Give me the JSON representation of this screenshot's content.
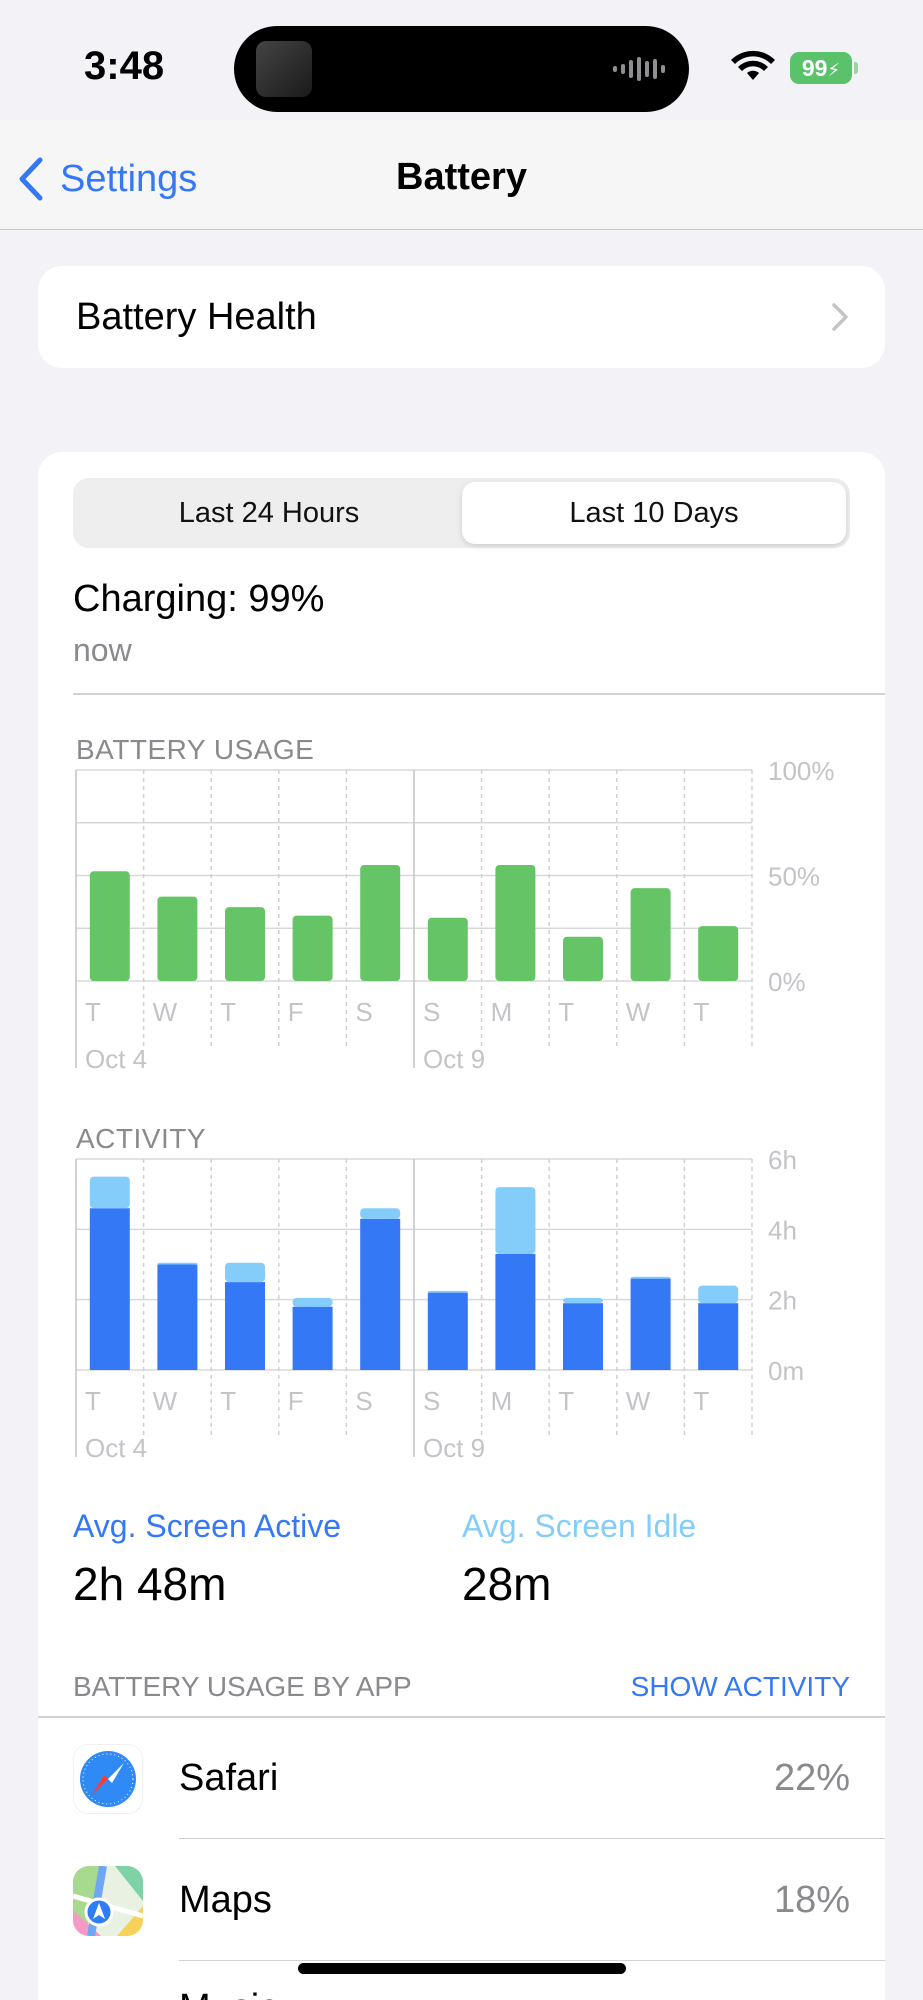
{
  "status_bar": {
    "time": "3:48",
    "battery_level": "99",
    "battery_color": "#5ac26a"
  },
  "nav": {
    "back_label": "Settings",
    "title": "Battery"
  },
  "battery_health": {
    "label": "Battery Health"
  },
  "segmented": {
    "left": "Last 24 Hours",
    "right": "Last 10 Days",
    "selected": "Last 10 Days"
  },
  "charging": {
    "title": "Charging: 99%",
    "subtitle": "now"
  },
  "colors": {
    "accent": "#3478f6",
    "usage_bar": "#65c466",
    "active_bar": "#3478f6",
    "idle_bar": "#84cdfb"
  },
  "chart_data": [
    {
      "type": "bar",
      "title": "BATTERY USAGE",
      "categories": [
        "T",
        "W",
        "T",
        "F",
        "S",
        "S",
        "M",
        "T",
        "W",
        "T"
      ],
      "date_labels": [
        {
          "index": 0,
          "text": "Oct 4"
        },
        {
          "index": 5,
          "text": "Oct 9"
        }
      ],
      "y_tick_labels": [
        "100%",
        "50%",
        "0%"
      ],
      "ylim": [
        0,
        100
      ],
      "series": [
        {
          "values": [
            52,
            40,
            35,
            31,
            55,
            30,
            55,
            21,
            44,
            26
          ]
        }
      ]
    },
    {
      "type": "bar",
      "title": "ACTIVITY",
      "stacked": true,
      "categories": [
        "T",
        "W",
        "T",
        "F",
        "S",
        "S",
        "M",
        "T",
        "W",
        "T"
      ],
      "date_labels": [
        {
          "index": 0,
          "text": "Oct 4"
        },
        {
          "index": 5,
          "text": "Oct 9"
        }
      ],
      "y_tick_labels": [
        "6h",
        "4h",
        "2h",
        "0m"
      ],
      "ylim": [
        0,
        6
      ],
      "series": [
        {
          "values": [
            4.6,
            3.0,
            2.5,
            1.8,
            4.3,
            2.2,
            3.3,
            1.9,
            2.6,
            1.9
          ]
        },
        {
          "values": [
            0.9,
            0.05,
            0.55,
            0.25,
            0.3,
            0.05,
            1.9,
            0.15,
            0.05,
            0.5
          ]
        }
      ]
    }
  ],
  "averages": {
    "active_label": "Avg. Screen Active",
    "active_value": "2h 48m",
    "idle_label": "Avg. Screen Idle",
    "idle_value": "28m"
  },
  "app_section": {
    "title": "BATTERY USAGE BY APP",
    "action": "SHOW ACTIVITY"
  },
  "apps": [
    {
      "name": "Safari",
      "percent": "22%",
      "icon": "safari-icon"
    },
    {
      "name": "Maps",
      "percent": "18%",
      "icon": "maps-icon"
    },
    {
      "name": "Music",
      "percent": "",
      "icon": "music-icon"
    }
  ]
}
